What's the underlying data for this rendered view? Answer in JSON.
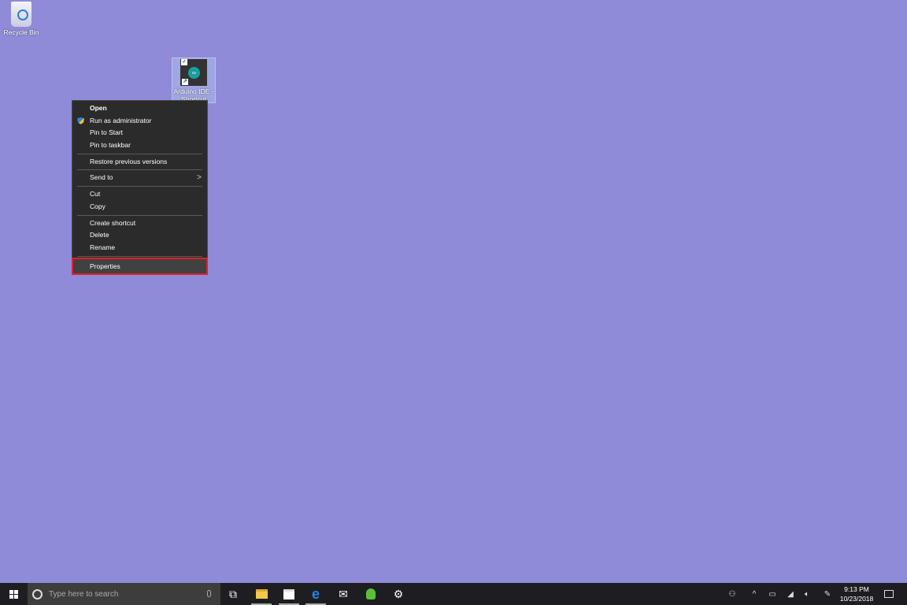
{
  "desktop": {
    "background": "#8f8bd9",
    "icons": [
      {
        "label": "Recycle Bin",
        "icon": "recycle-bin-icon"
      },
      {
        "label": "Arduino IDE - Shortcut",
        "icon": "arduino-icon"
      }
    ]
  },
  "context_menu": {
    "items": [
      {
        "label": "Open"
      },
      {
        "label": "Run as administrator",
        "icon": "uac-shield-icon"
      },
      {
        "label": "Pin to Start"
      },
      {
        "label": "Pin to taskbar"
      },
      {
        "label": "Restore previous versions"
      },
      {
        "label": "Send to",
        "icon": "chevron-right-icon"
      },
      {
        "label": "Cut"
      },
      {
        "label": "Copy"
      },
      {
        "label": "Create shortcut"
      },
      {
        "label": "Delete"
      },
      {
        "label": "Rename"
      },
      {
        "label": "Properties"
      }
    ],
    "highlight_color": "#e0202a"
  },
  "taskbar": {
    "search_placeholder": "Type here to search",
    "apps": [
      "task-view-icon",
      "file-explorer-icon",
      "store-icon",
      "edge-icon",
      "mail-icon",
      "android-app-icon",
      "settings-icon"
    ],
    "clock": {
      "time": "9:13 PM",
      "date": "10/23/2018"
    }
  }
}
